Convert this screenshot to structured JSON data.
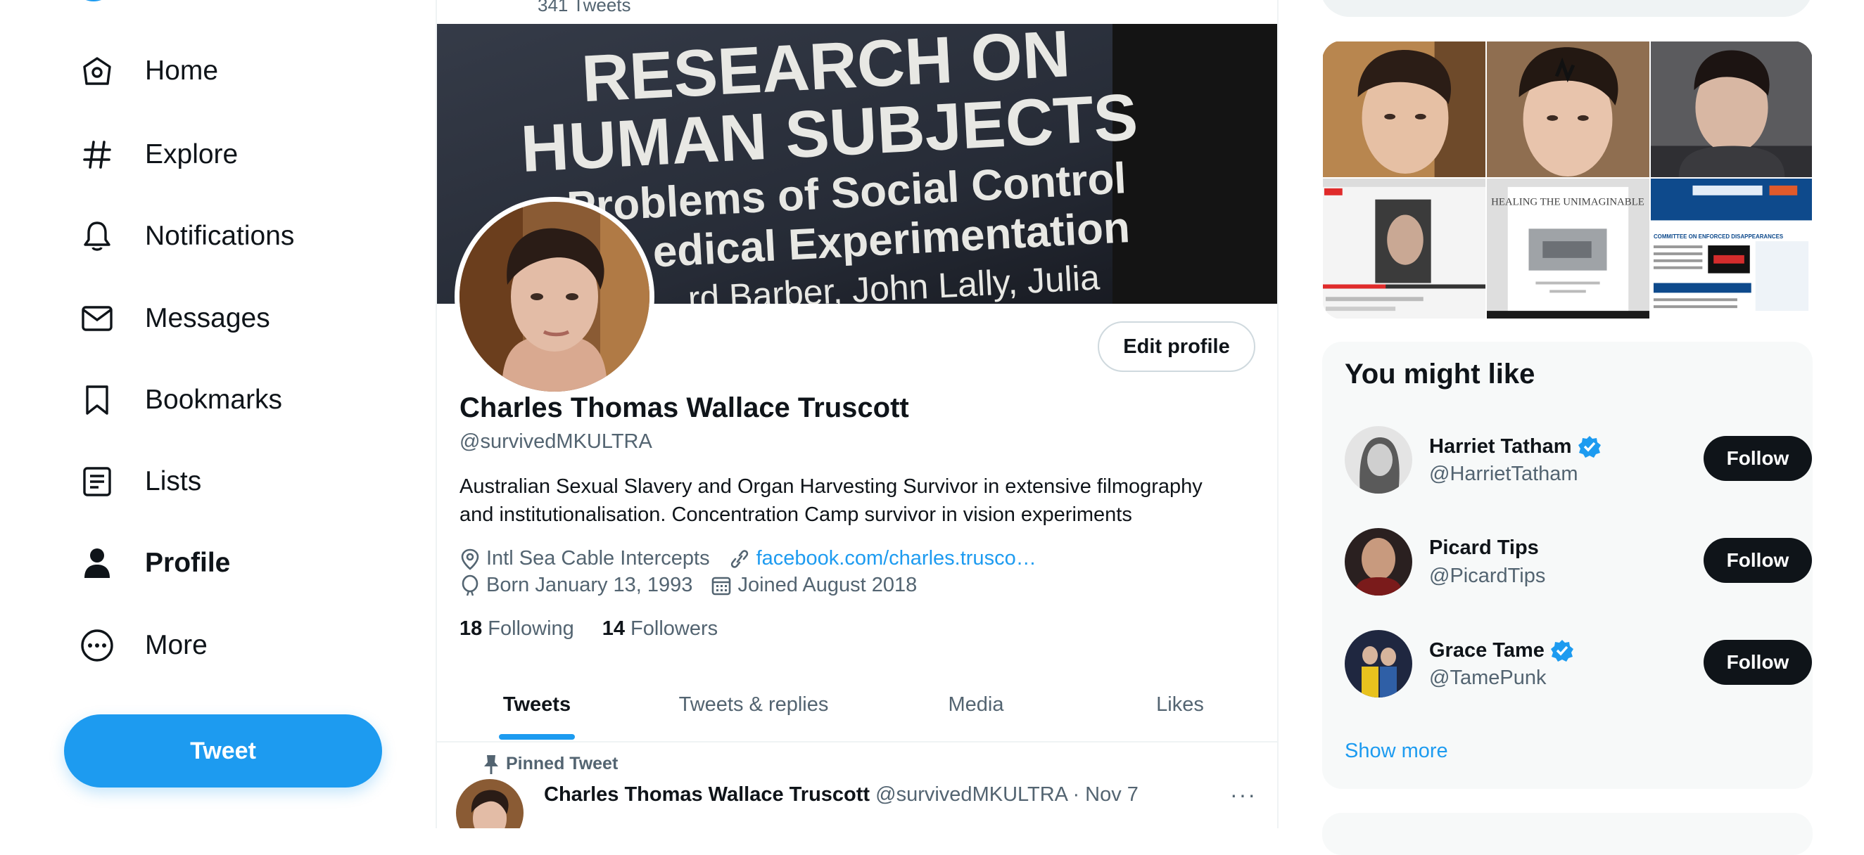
{
  "nav": {
    "items": [
      {
        "label": "Home",
        "icon": "home-icon"
      },
      {
        "label": "Explore",
        "icon": "hashtag-icon"
      },
      {
        "label": "Notifications",
        "icon": "bell-icon"
      },
      {
        "label": "Messages",
        "icon": "envelope-icon"
      },
      {
        "label": "Bookmarks",
        "icon": "bookmark-icon"
      },
      {
        "label": "Lists",
        "icon": "list-icon"
      },
      {
        "label": "Profile",
        "icon": "person-icon",
        "active": true
      },
      {
        "label": "More",
        "icon": "more-circle-icon"
      }
    ],
    "tweet_button": "Tweet"
  },
  "profile": {
    "tweet_count": "341 Tweets",
    "banner_text": [
      "RESEARCH ON",
      "HUMAN SUBJECTS",
      "Problems of Social Control",
      "edical Experimentation",
      "rd Barber, John Lally, Julia"
    ],
    "edit_button": "Edit profile",
    "name": "Charles Thomas Wallace Truscott",
    "handle": "@survivedMKULTRA",
    "bio_line1": "Australian Sexual Slavery and Organ Harvesting Survivor in extensive filmography",
    "bio_line2": "and institutionalisation. Concentration Camp survivor in vision experiments",
    "location": "Intl Sea Cable Intercepts",
    "website": "facebook.com/charles.trusco…",
    "born": "Born January 13, 1993",
    "joined": "Joined August 2018",
    "following_count": "18",
    "following_label": "Following",
    "followers_count": "14",
    "followers_label": "Followers"
  },
  "tabs": [
    "Tweets",
    "Tweets & replies",
    "Media",
    "Likes"
  ],
  "pinned": {
    "label": "Pinned Tweet",
    "name": "Charles Thomas Wallace Truscott",
    "meta": "@survivedMKULTRA · Nov 7",
    "more": "···"
  },
  "media_preview": {
    "thumbs": [
      {
        "type": "selfie"
      },
      {
        "type": "selfie-mark"
      },
      {
        "type": "selfie-dark"
      },
      {
        "type": "screenshot-video"
      },
      {
        "type": "screenshot-document",
        "heading": "HEALING THE UNIMAGINABLE"
      },
      {
        "type": "screenshot-web",
        "heading": "COMMITTEE ON ENFORCED DISAPPEARANCES"
      }
    ]
  },
  "who_to_follow": {
    "title": "You might like",
    "accounts": [
      {
        "name": "Harriet Tatham",
        "handle": "@HarrietTatham",
        "verified": true,
        "button": "Follow"
      },
      {
        "name": "Picard Tips",
        "handle": "@PicardTips",
        "verified": false,
        "button": "Follow"
      },
      {
        "name": "Grace Tame",
        "handle": "@TamePunk",
        "verified": true,
        "button": "Follow"
      }
    ],
    "show_more": "Show more"
  },
  "colors": {
    "accent": "#1d9bf0",
    "text": "#0f1419",
    "secondary": "#536471",
    "follow_bg": "#0f1419"
  }
}
